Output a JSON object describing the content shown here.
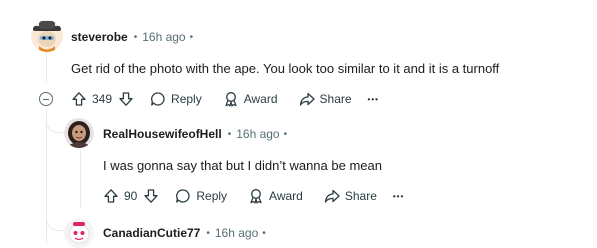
{
  "comments": [
    {
      "author": "steverobe",
      "time": "16h ago",
      "body": "Get rid of the photo with the ape. You look too similar to it and it is a turnoff",
      "score": "349",
      "reply_label": "Reply",
      "award_label": "Award",
      "share_label": "Share",
      "more_label": "•••"
    },
    {
      "author": "RealHousewifeofHell",
      "time": "16h ago",
      "body": "I was gonna say that but I didn’t wanna be mean",
      "score": "90",
      "reply_label": "Reply",
      "award_label": "Award",
      "share_label": "Share",
      "more_label": "•••"
    },
    {
      "author": "CanadianCutie77",
      "time": "16h ago"
    }
  ],
  "separators": {
    "dot": "•"
  },
  "icons": {
    "upvote": "upvote-icon",
    "downvote": "downvote-icon",
    "reply": "comment-bubble-icon",
    "award": "award-icon",
    "share": "share-arrow-icon",
    "collapse": "collapse-minus-icon"
  },
  "colors": {
    "text": "#1c1c1c",
    "meta": "#576f76",
    "action": "#2a3c42",
    "thread": "#e5ebee"
  }
}
